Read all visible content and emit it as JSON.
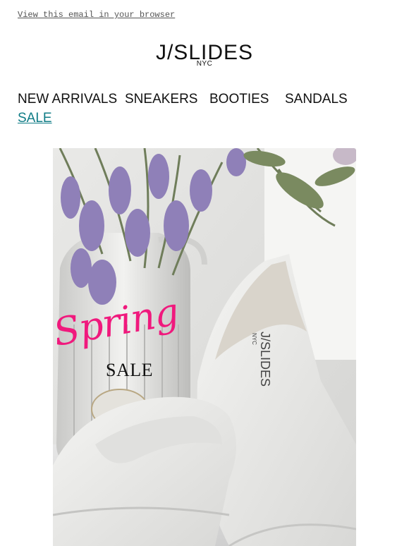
{
  "header": {
    "view_in_browser": "View this email in your browser"
  },
  "logo": {
    "main": "J/SLIDES",
    "sub": "NYC"
  },
  "nav": {
    "items": [
      {
        "label": "NEW ARRIVALS"
      },
      {
        "label": "SNEAKERS"
      },
      {
        "label": "BOOTIES"
      },
      {
        "label": "SANDALS"
      },
      {
        "label": "SALE"
      }
    ],
    "sale_color": "#0f7c86"
  },
  "hero": {
    "headline_script": "Spring",
    "headline_sale": "SALE",
    "shoe_insole_text": "J/SLIDES",
    "shoe_insole_sub": "NYC",
    "accent_color": "#f0197d"
  }
}
